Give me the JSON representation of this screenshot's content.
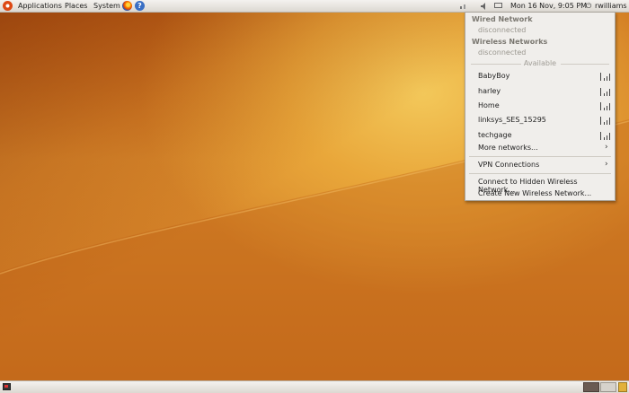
{
  "top_panel": {
    "menus": {
      "applications": "Applications",
      "places": "Places",
      "system": "System"
    },
    "help_glyph": "?",
    "icons": [
      "ubuntu-logo",
      "firefox-icon",
      "help-icon",
      "network-icon",
      "volume-icon",
      "mail-icon",
      "power-icon"
    ],
    "clock": "Mon 16 Nov,  9:05 PM",
    "user": "rwilliams"
  },
  "network_menu": {
    "wired_heading": "Wired Network",
    "wired_status": "disconnected",
    "wireless_heading": "Wireless Networks",
    "wireless_status": "disconnected",
    "available_label": "Available",
    "networks": [
      "BabyBoy",
      "harley",
      "Home",
      "linksys_SES_15295",
      "techgage"
    ],
    "more_networks": "More networks...",
    "vpn": "VPN Connections",
    "connect_hidden": "Connect to Hidden Wireless Network...",
    "create_new": "Create New Wireless Network..."
  },
  "colors": {
    "accent_ubuntu": "#dd4814",
    "panel": "#e8e6e2",
    "menu_bg": "#f0eeeb"
  }
}
